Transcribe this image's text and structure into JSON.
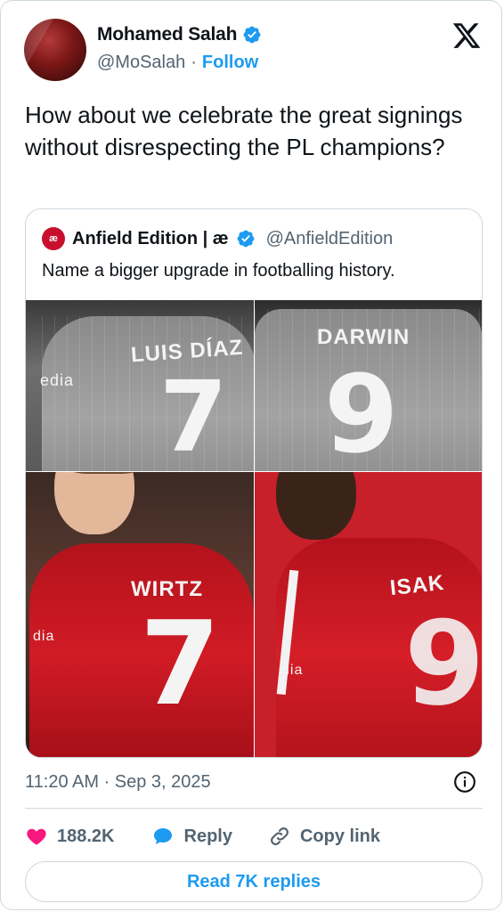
{
  "author": {
    "display_name": "Mohamed Salah",
    "handle": "@MoSalah",
    "separator": "·",
    "follow_label": "Follow",
    "verified": true
  },
  "platform_logo": "x-logo-icon",
  "tweet": {
    "text": "How about we celebrate the great signings without disrespecting the PL champions?"
  },
  "quote": {
    "avatar_text": "æ",
    "display_name": "Anfield Edition | æ",
    "handle": "@AnfieldEdition",
    "text": "Name a bigger upgrade in footballing history.",
    "image": {
      "tiles": [
        {
          "shirt_name": "LUIS DÍAZ",
          "shirt_number": "7",
          "sponsor": "edia"
        },
        {
          "shirt_name": "DARWIN",
          "shirt_number": "9"
        },
        {
          "shirt_name": "WIRTZ",
          "shirt_number": "7",
          "sponsor": "dia"
        },
        {
          "shirt_name": "ISAK",
          "shirt_number": "9",
          "sponsor": "dia"
        }
      ]
    }
  },
  "timestamp": "11:20 AM · Sep 3, 2025",
  "actions": {
    "likes": "188.2K",
    "reply_label": "Reply",
    "copy_link_label": "Copy link"
  },
  "read_replies_label": "Read 7K replies",
  "colors": {
    "accent": "#1d9bf0",
    "like": "#f91880",
    "liverpool_red": "#c8102e"
  }
}
